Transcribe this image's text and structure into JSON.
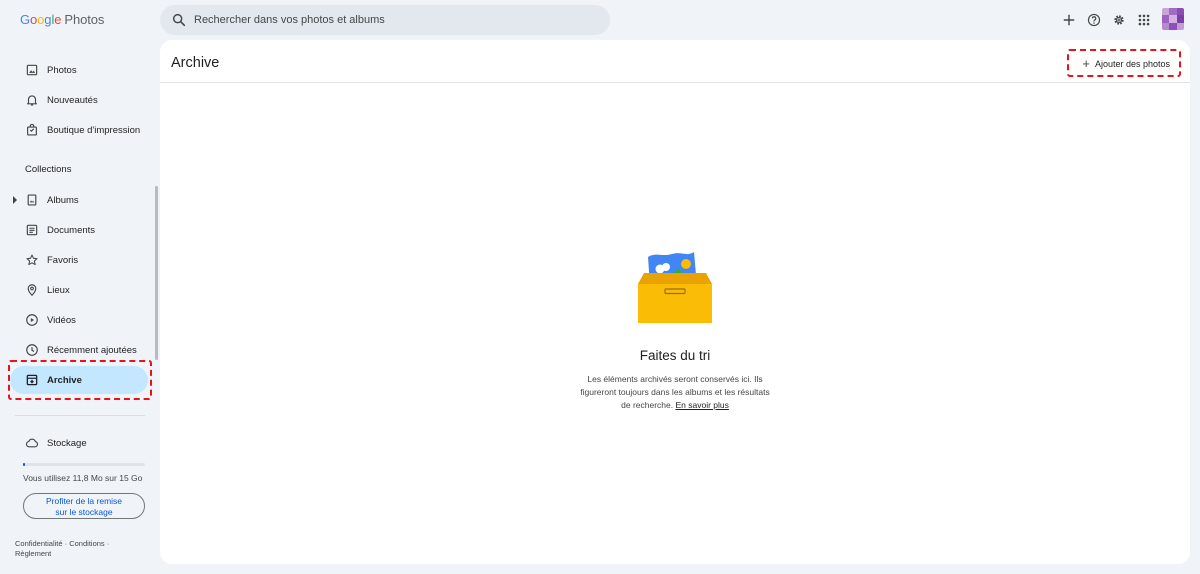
{
  "app": {
    "logo_letters": [
      "G",
      "o",
      "o",
      "g",
      "l",
      "e"
    ],
    "logo_product": "Photos"
  },
  "search": {
    "placeholder": "Rechercher dans vos photos et albums"
  },
  "topbar_icons": [
    "plus-icon",
    "help-icon",
    "settings-icon",
    "apps-grid-icon",
    "avatar"
  ],
  "sidebar": {
    "items_top": [
      {
        "label": "Photos",
        "icon": "photo-icon"
      },
      {
        "label": "Nouveautés",
        "icon": "bell-icon"
      },
      {
        "label": "Boutique d'impression",
        "icon": "shopping-bag-icon"
      }
    ],
    "collections_label": "Collections",
    "items_collections": [
      {
        "label": "Albums",
        "icon": "album-icon"
      },
      {
        "label": "Documents",
        "icon": "document-icon"
      },
      {
        "label": "Favoris",
        "icon": "star-icon"
      },
      {
        "label": "Lieux",
        "icon": "location-pin-icon"
      },
      {
        "label": "Vidéos",
        "icon": "play-circle-icon"
      },
      {
        "label": "Récemment ajoutées",
        "icon": "clock-icon"
      },
      {
        "label": "Archive",
        "icon": "archive-icon",
        "active": true
      }
    ],
    "storage_label": "Stockage",
    "storage_used_fraction": 0.0008,
    "storage_text": "Vous utilisez 11,8 Mo sur 15 Go",
    "promo_line1": "Profiter de la remise",
    "promo_line2": "sur le stockage",
    "footer_privacy": "Confidentialité",
    "footer_sep": "·",
    "footer_terms": "Conditions",
    "footer_policy": "Règlement"
  },
  "main": {
    "title": "Archive",
    "add_button": "Ajouter des photos",
    "empty_title": "Faites du tri",
    "empty_desc": "Les éléments archivés seront conservés ici. Ils figureront toujours dans les albums et les résultats de recherche.",
    "learn_more": "En savoir plus"
  },
  "colors": {
    "active_bg": "#c2e7ff",
    "accent": "#0b57d0",
    "highlight": "#e5131b"
  }
}
